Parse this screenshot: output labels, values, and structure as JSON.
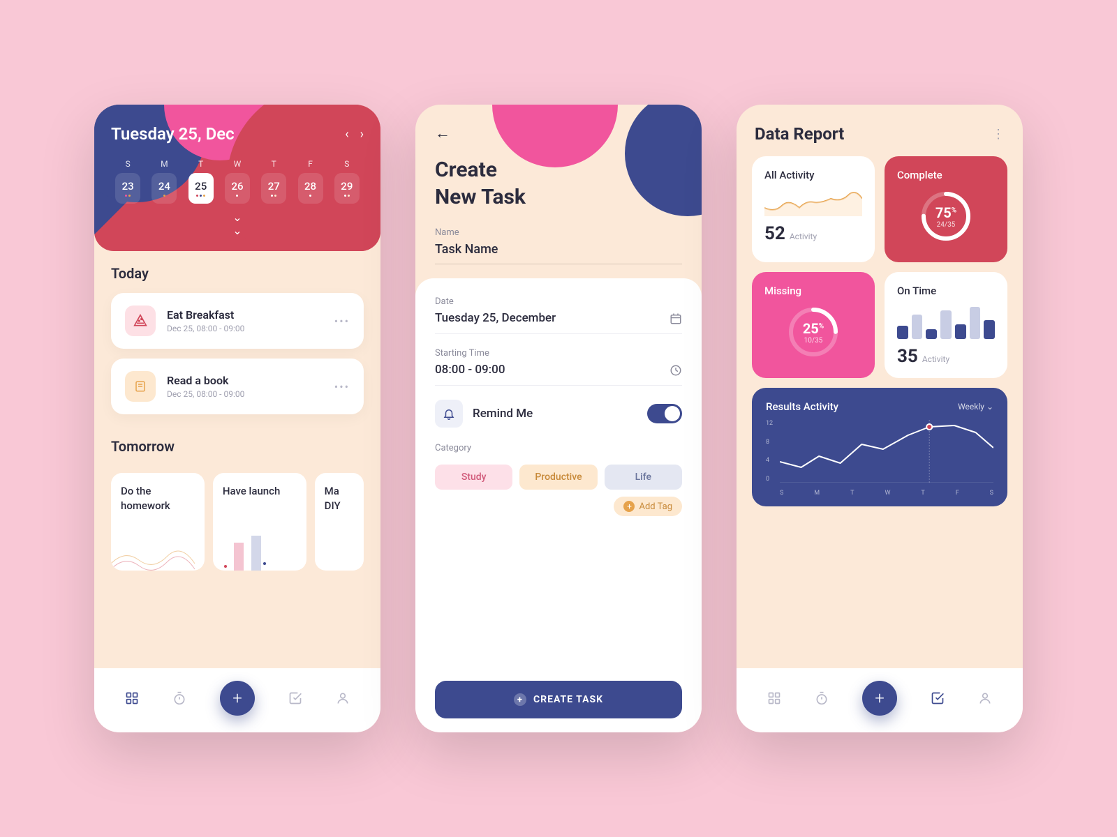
{
  "screen1": {
    "date_title": "Tuesday 25, Dec",
    "dows": [
      "S",
      "M",
      "T",
      "W",
      "T",
      "F",
      "S"
    ],
    "dates": [
      23,
      24,
      25,
      26,
      27,
      28,
      29
    ],
    "selected_index": 2,
    "today_label": "Today",
    "tasks": [
      {
        "name": "Eat Breakfast",
        "time": "Dec 25, 08:00 - 09:00"
      },
      {
        "name": "Read a book",
        "time": "Dec 25, 08:00 - 09:00"
      }
    ],
    "tomorrow_label": "Tomorrow",
    "tomorrow_cards": [
      "Do the homework",
      "Have launch",
      "Ma DIY"
    ]
  },
  "screen2": {
    "title_line1": "Create",
    "title_line2": "New Task",
    "name_label": "Name",
    "name_value": "Task Name",
    "date_label": "Date",
    "date_value": "Tuesday 25, December",
    "time_label": "Starting Time",
    "time_value": "08:00 - 09:00",
    "remind_label": "Remind Me",
    "remind_on": true,
    "category_label": "Category",
    "categories": [
      "Study",
      "Productive",
      "Life"
    ],
    "add_tag_label": "Add Tag",
    "submit_label": "CREATE TASK"
  },
  "screen3": {
    "title": "Data Report",
    "cards": {
      "all_activity": {
        "title": "All Activity",
        "value": 52,
        "unit": "Activity"
      },
      "complete": {
        "title": "Complete",
        "percent": 75,
        "current": 24,
        "total": 35
      },
      "missing": {
        "title": "Missing",
        "percent": 25,
        "current": 10,
        "total": 35
      },
      "on_time": {
        "title": "On Time",
        "value": 35,
        "unit": "Activity"
      }
    },
    "results": {
      "title": "Results Activity",
      "period": "Weekly",
      "y_ticks": [
        12,
        8,
        4,
        0
      ],
      "x_labels": [
        "S",
        "M",
        "T",
        "W",
        "T",
        "F",
        "S"
      ]
    }
  },
  "chart_data": [
    {
      "type": "line",
      "title": "All Activity",
      "values": [
        0.4,
        0.2,
        0.5,
        0.45,
        0.7,
        0.6,
        0.85,
        0.7
      ]
    },
    {
      "type": "bar",
      "title": "On Time",
      "values": [
        20,
        38,
        15,
        45,
        22,
        50,
        30
      ],
      "ylim": [
        0,
        55
      ]
    },
    {
      "type": "line",
      "title": "Results Activity",
      "categories": [
        "S",
        "M",
        "T",
        "W",
        "T",
        "F",
        "S"
      ],
      "values": [
        4,
        3,
        5,
        4,
        8,
        7,
        10,
        12,
        11,
        8
      ],
      "ylim": [
        0,
        12
      ],
      "highlight_index": 7
    }
  ],
  "colors": {
    "navy": "#3d4a8f",
    "red": "#d14659",
    "pink": "#f1559d",
    "peach": "#fce9d8"
  }
}
